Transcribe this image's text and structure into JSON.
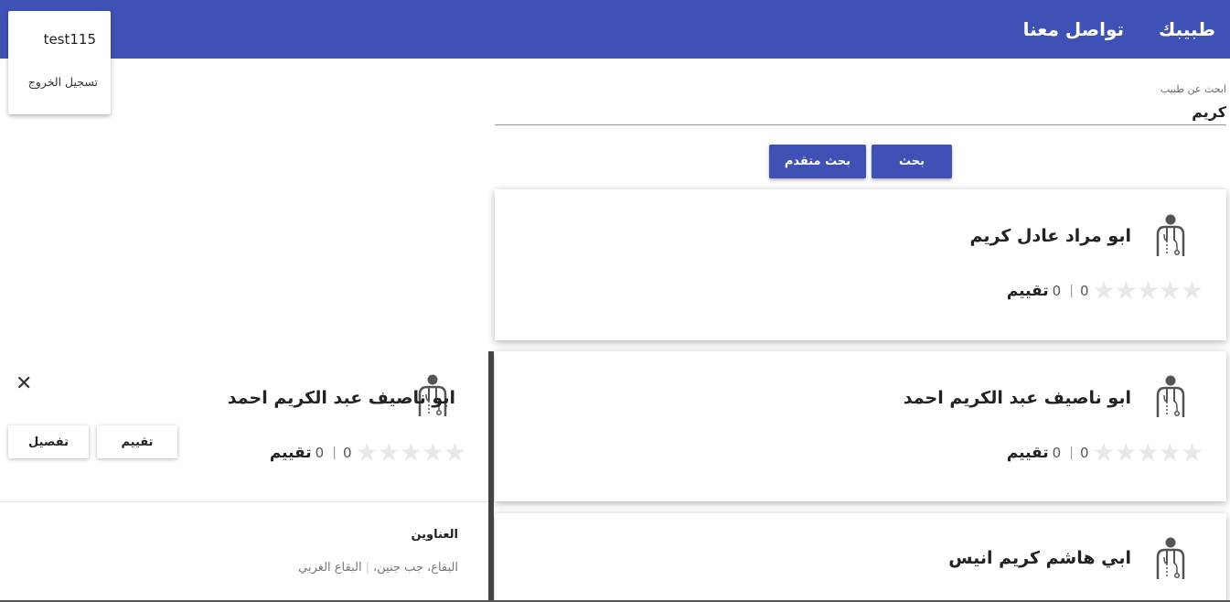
{
  "header": {
    "brand": "طبيبك",
    "contact": "تواصل معنا"
  },
  "user_menu": {
    "username": "test115",
    "logout": "تسجيل الخروج"
  },
  "search": {
    "label": "ابحث عن طبيب",
    "value": "كريم",
    "search_button": "بحث",
    "advanced_button": "بحث متقدم"
  },
  "results": [
    {
      "name": "ابو مراد عادل كريم",
      "rating_stars": 0,
      "rating_count": "0",
      "separator": "|",
      "rating_label": "تقييم"
    },
    {
      "name": "ابو ناصيف عبد الكريم احمد",
      "rating_stars": 0,
      "rating_count": "0",
      "separator": "|",
      "rating_label": "تقييم"
    },
    {
      "name": "ابي هاشم كريم انيس",
      "rating_stars": 0,
      "rating_count": "0",
      "separator": "|",
      "rating_label": "تقييم"
    }
  ],
  "detail": {
    "name": "ابو ناصيف عبد الكريم احمد",
    "rating_stars": 0,
    "rating_count": "0",
    "separator": "|",
    "rating_label": "تقييم",
    "rate_button": "تقييم",
    "details_button": "تفصيل",
    "close_icon": "close-icon",
    "addresses_title": "العناوين",
    "address_part1": "البقاع، جب جنين،",
    "address_part2": "البقاع الغربي"
  },
  "icons": {
    "doctor": "doctor-icon",
    "star": "star-icon"
  },
  "colors": {
    "primary": "#3f51b5",
    "star_empty": "#e8e8e8",
    "detail_border": "#444444"
  }
}
